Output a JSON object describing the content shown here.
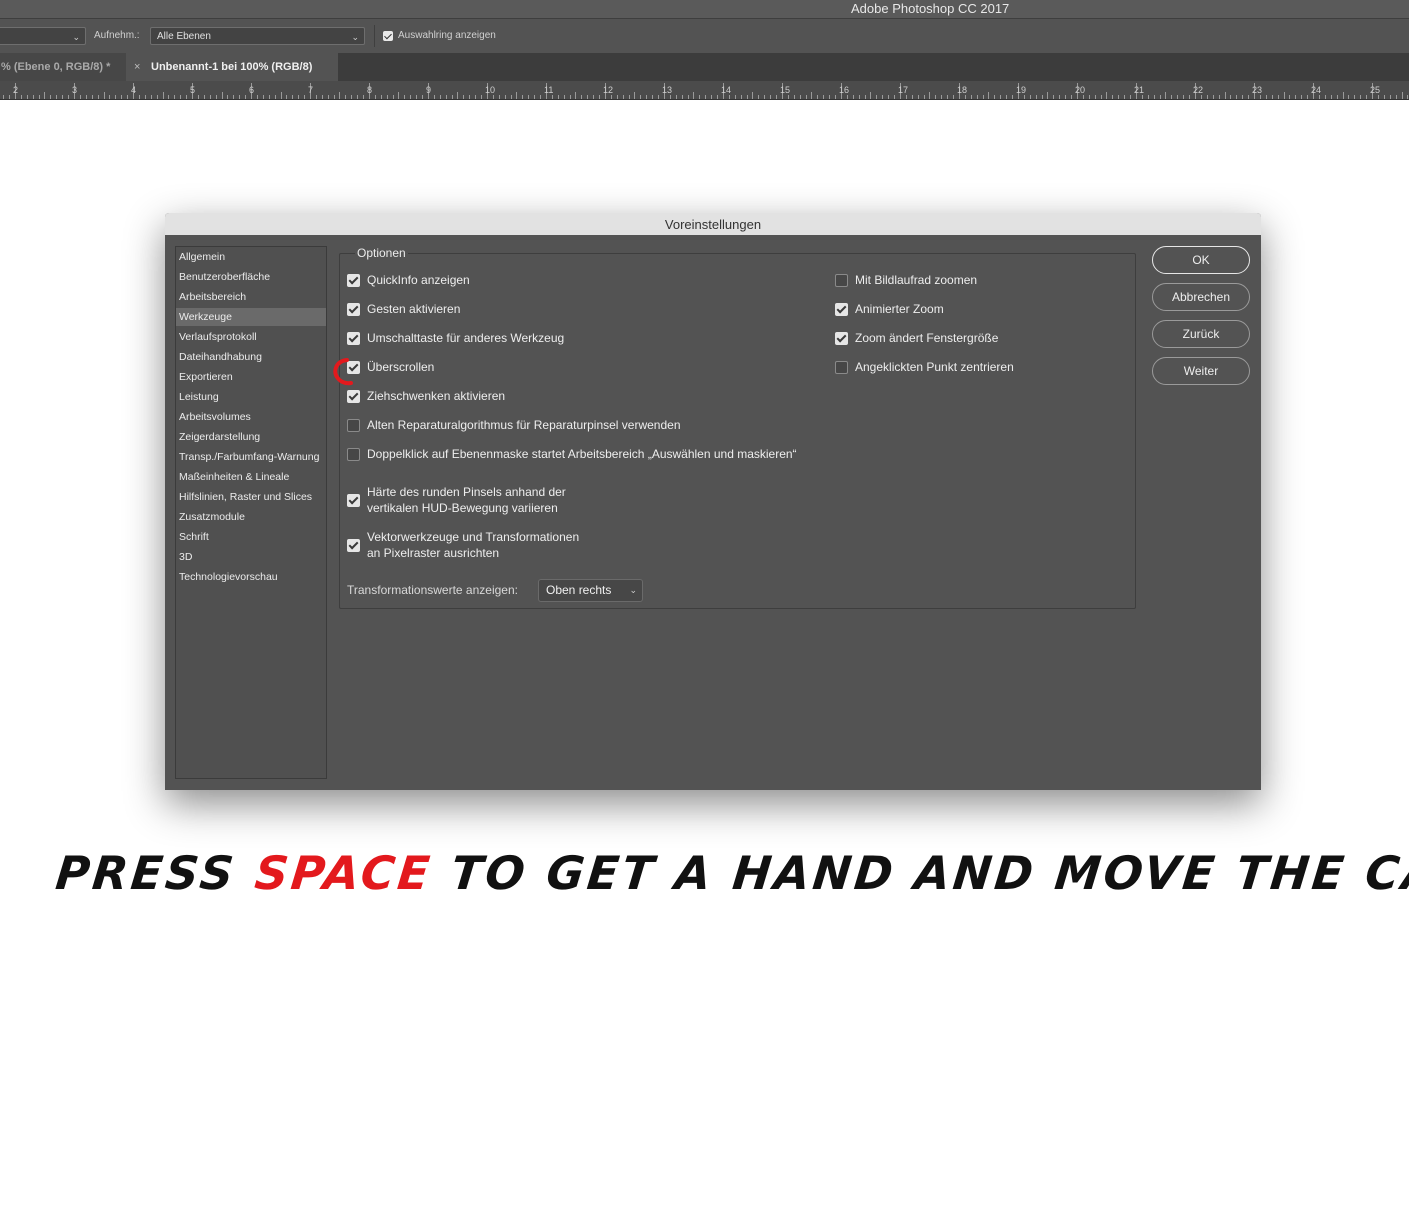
{
  "app": {
    "title": "Adobe Photoshop CC 2017"
  },
  "options_bar": {
    "sample_label": "Aufnehm.:",
    "sample_value": "Alle Ebenen",
    "show_ring_label": "Auswahlring anzeigen",
    "show_ring_checked": true
  },
  "tabs": [
    {
      "label": "% (Ebene 0, RGB/8) *",
      "active": false
    },
    {
      "label": "Unbenannt-1 bei 100% (RGB/8)",
      "active": true,
      "close": "×"
    }
  ],
  "ruler": {
    "numbers": [
      "2",
      "3",
      "4",
      "5",
      "6",
      "7",
      "8",
      "9",
      "10",
      "11",
      "12",
      "13",
      "14",
      "15",
      "16",
      "17",
      "18",
      "19",
      "20",
      "21",
      "22",
      "23",
      "24",
      "25"
    ]
  },
  "dialog": {
    "title": "Voreinstellungen",
    "nav": [
      {
        "label": "Allgemein"
      },
      {
        "label": "Benutzeroberfläche"
      },
      {
        "label": "Arbeitsbereich"
      },
      {
        "label": "Werkzeuge",
        "selected": true
      },
      {
        "label": "Verlaufsprotokoll"
      },
      {
        "label": "Dateihandhabung"
      },
      {
        "label": "Exportieren"
      },
      {
        "label": "Leistung"
      },
      {
        "label": "Arbeitsvolumes"
      },
      {
        "label": "Zeigerdarstellung"
      },
      {
        "label": "Transp./Farbumfang-Warnung"
      },
      {
        "label": "Maßeinheiten & Lineale"
      },
      {
        "label": "Hilfslinien, Raster und Slices"
      },
      {
        "label": "Zusatzmodule"
      },
      {
        "label": "Schrift"
      },
      {
        "label": "3D"
      },
      {
        "label": "Technologievorschau"
      }
    ],
    "group_title": "Optionen",
    "options_left": [
      {
        "label": "QuickInfo anzeigen",
        "checked": true
      },
      {
        "label": "Gesten aktivieren",
        "checked": true
      },
      {
        "label": "Umschalttaste für anderes Werkzeug",
        "checked": true
      },
      {
        "label": "Überscrollen",
        "checked": true
      },
      {
        "label": "Ziehschwenken aktivieren",
        "checked": true
      },
      {
        "label": "Alten Reparaturalgorithmus für Reparaturpinsel verwenden",
        "checked": false
      },
      {
        "label": "Doppelklick auf Ebenenmaske startet Arbeitsbereich „Auswählen und maskieren“",
        "checked": false
      },
      {
        "label_line1": "Härte des runden Pinsels anhand der",
        "label_line2": "vertikalen HUD-Bewegung variieren",
        "checked": true
      },
      {
        "label_line1": "Vektorwerkzeuge und Transformationen",
        "label_line2": "an Pixelraster ausrichten",
        "checked": true
      }
    ],
    "options_right": [
      {
        "label": "Mit Bildlaufrad zoomen",
        "checked": false
      },
      {
        "label": "Animierter Zoom",
        "checked": true
      },
      {
        "label": "Zoom ändert Fenstergröße",
        "checked": true
      },
      {
        "label": "Angeklickten Punkt zentrieren",
        "checked": false
      }
    ],
    "transform_label": "Transformationswerte anzeigen:",
    "transform_value": "Oben rechts",
    "buttons": {
      "ok": "OK",
      "cancel": "Abbrechen",
      "back": "Zurück",
      "next": "Weiter"
    }
  },
  "caption": {
    "before": "PRESS ",
    "highlight": "SPACE",
    "after": " TO GET A HAND AND MOVE THE CANVAS",
    "highlight_color": "#e3191d"
  }
}
